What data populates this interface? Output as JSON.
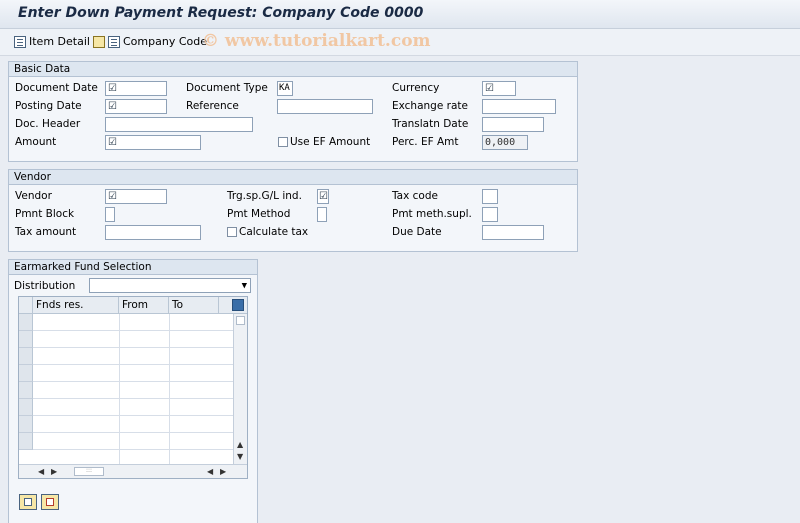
{
  "window": {
    "title": "Enter Down Payment Request: Company Code 0000"
  },
  "toolbar": {
    "item_detail": "Item Detail",
    "company_code": "Company Code",
    "watermark": "© www.tutorialkart.com"
  },
  "basic_data": {
    "header": "Basic Data",
    "document_date_label": "Document Date",
    "document_date_value": "☑",
    "posting_date_label": "Posting Date",
    "posting_date_value": "☑",
    "doc_header_label": "Doc. Header",
    "amount_label": "Amount",
    "amount_value": "☑",
    "document_type_label": "Document Type",
    "document_type_value": "KA",
    "reference_label": "Reference",
    "use_ef_amount_label": "Use EF Amount",
    "currency_label": "Currency",
    "currency_value": "☑",
    "exchange_rate_label": "Exchange rate",
    "translatn_date_label": "Translatn Date",
    "perc_ef_amt_label": "Perc. EF Amt",
    "perc_ef_amt_value": "0,000"
  },
  "vendor": {
    "header": "Vendor",
    "vendor_label": "Vendor",
    "vendor_value": "☑",
    "pmnt_block_label": "Pmnt Block",
    "tax_amount_label": "Tax amount",
    "trg_sp_gl_label": "Trg.sp.G/L ind.",
    "trg_sp_gl_value": "☑",
    "pmt_method_label": "Pmt Method",
    "calculate_tax_label": "Calculate tax",
    "tax_code_label": "Tax code",
    "pmt_meth_supl_label": "Pmt meth.supl.",
    "due_date_label": "Due Date"
  },
  "earmarked": {
    "header": "Earmarked Fund Selection",
    "distribution_label": "Distribution",
    "columns": [
      "Fnds res.",
      "From",
      "To"
    ]
  }
}
